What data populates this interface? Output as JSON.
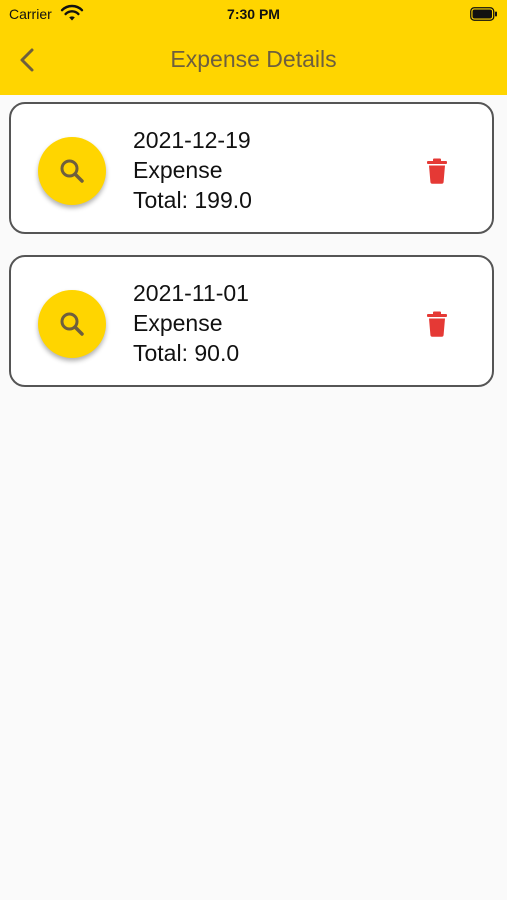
{
  "status_bar": {
    "carrier": "Carrier",
    "time": "7:30 PM",
    "icons": [
      "wifi-icon",
      "battery-icon"
    ]
  },
  "app_bar": {
    "title": "Expense Details",
    "back_icon": "chevron-left-icon",
    "color": "#FFD500"
  },
  "expenses": [
    {
      "date": "2021-12-19",
      "type": "Expense",
      "total": "Total: 199.0"
    },
    {
      "date": "2021-11-01",
      "type": "Expense",
      "total": "Total: 90.0"
    }
  ],
  "icons": {
    "view": "search-icon",
    "delete": "trash-icon"
  },
  "colors": {
    "accent": "#FFD500",
    "delete": "#E53935",
    "title_text": "#6E5F3E",
    "background": "#FAFAFA"
  }
}
